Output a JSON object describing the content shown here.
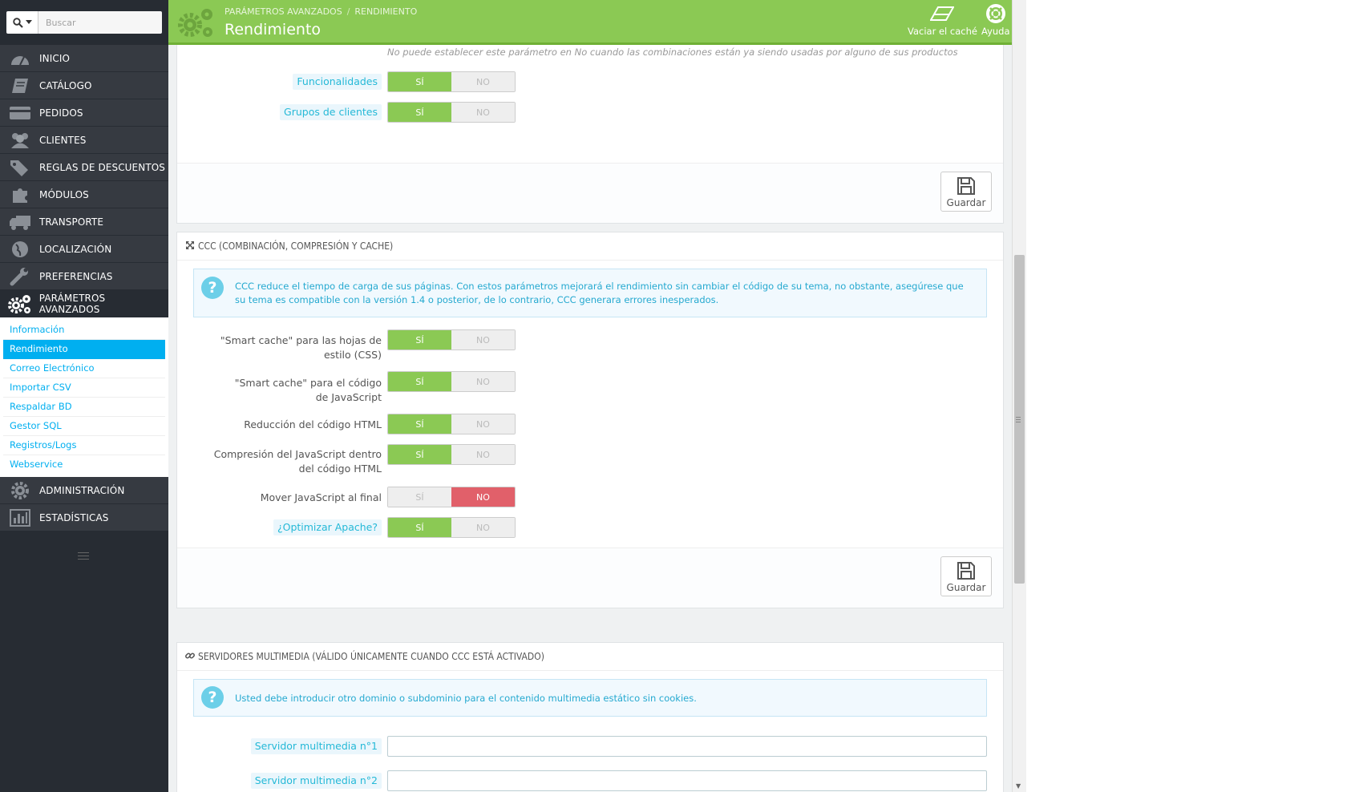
{
  "search": {
    "placeholder": "Buscar"
  },
  "nav": {
    "items": [
      {
        "label": "INICIO",
        "icon": "dashboard-icon"
      },
      {
        "label": "CATÁLOGO",
        "icon": "book-icon"
      },
      {
        "label": "PEDIDOS",
        "icon": "credit-card-icon"
      },
      {
        "label": "CLIENTES",
        "icon": "users-icon"
      },
      {
        "label": "REGLAS DE DESCUENTOS",
        "icon": "tags-icon"
      },
      {
        "label": "MÓDULOS",
        "icon": "puzzle-icon"
      },
      {
        "label": "TRANSPORTE",
        "icon": "truck-icon"
      },
      {
        "label": "LOCALIZACIÓN",
        "icon": "globe-icon"
      },
      {
        "label": "PREFERENCIAS",
        "icon": "wrench-icon"
      },
      {
        "label": "PARÁMETROS AVANZADOS",
        "icon": "gears-icon"
      },
      {
        "label": "ADMINISTRACIÓN",
        "icon": "gear-icon"
      },
      {
        "label": "ESTADÍSTICAS",
        "icon": "bar-chart-icon"
      }
    ],
    "submenu": [
      "Información",
      "Rendimiento",
      "Correo Electrónico",
      "Importar CSV",
      "Respaldar BD",
      "Gestor SQL",
      "Registros/Logs",
      "Webservice"
    ]
  },
  "header": {
    "breadcrumb": [
      "PARÁMETROS AVANZADOS",
      "RENDIMIENTO"
    ],
    "title": "Rendimiento",
    "clear_cache": "Vaciar el caché",
    "help": "Ayuda"
  },
  "panel1": {
    "hint": "No puede establecer este parámetro en No cuando las combinaciones están ya siendo usadas por alguno de sus productos",
    "rows": [
      {
        "label": "Funcionalidades",
        "value": "yes"
      },
      {
        "label": "Grupos de clientes",
        "value": "yes"
      }
    ],
    "save": "Guardar"
  },
  "switch": {
    "yes": "SÍ",
    "no": "NO"
  },
  "ccc": {
    "title": "CCC (COMBINACIÓN, COMPRESIÓN Y CACHE)",
    "info": "CCC reduce el tiempo de carga de sus páginas. Con estos parámetros mejorará el rendimiento sin cambiar el código de su tema, no obstante, asegúrese que su tema es compatible con la versión 1.4 o posterior, de lo contrario, CCC generara errores inesperados.",
    "rows": [
      {
        "label": "\"Smart cache\" para las hojas de estilo (CSS)",
        "value": "yes"
      },
      {
        "label": "\"Smart cache\" para el código de JavaScript",
        "value": "yes"
      },
      {
        "label": "Reducción del código HTML",
        "value": "yes"
      },
      {
        "label": "Compresión del JavaScript dentro del código HTML",
        "value": "yes"
      },
      {
        "label": "Mover JavaScript al final",
        "value": "no"
      },
      {
        "label": "¿Optimizar Apache?",
        "value": "yes"
      }
    ],
    "save": "Guardar"
  },
  "media": {
    "title": "SERVIDORES MULTIMEDIA (VÁLIDO ÚNICAMENTE CUANDO CCC ESTÁ ACTIVADO)",
    "info": "Usted debe introducir otro dominio o subdominio para el contenido multimedia estático sin cookies.",
    "server1_label": "Servidor multimedia n°1",
    "server1_value": "",
    "server2_label": "Servidor multimedia n°2",
    "server2_value": ""
  },
  "colors": {
    "header_green": "#8bc954",
    "sidebar_dark": "#363a41",
    "accent_blue": "#00aff0",
    "switch_no_red": "#e1606a"
  }
}
